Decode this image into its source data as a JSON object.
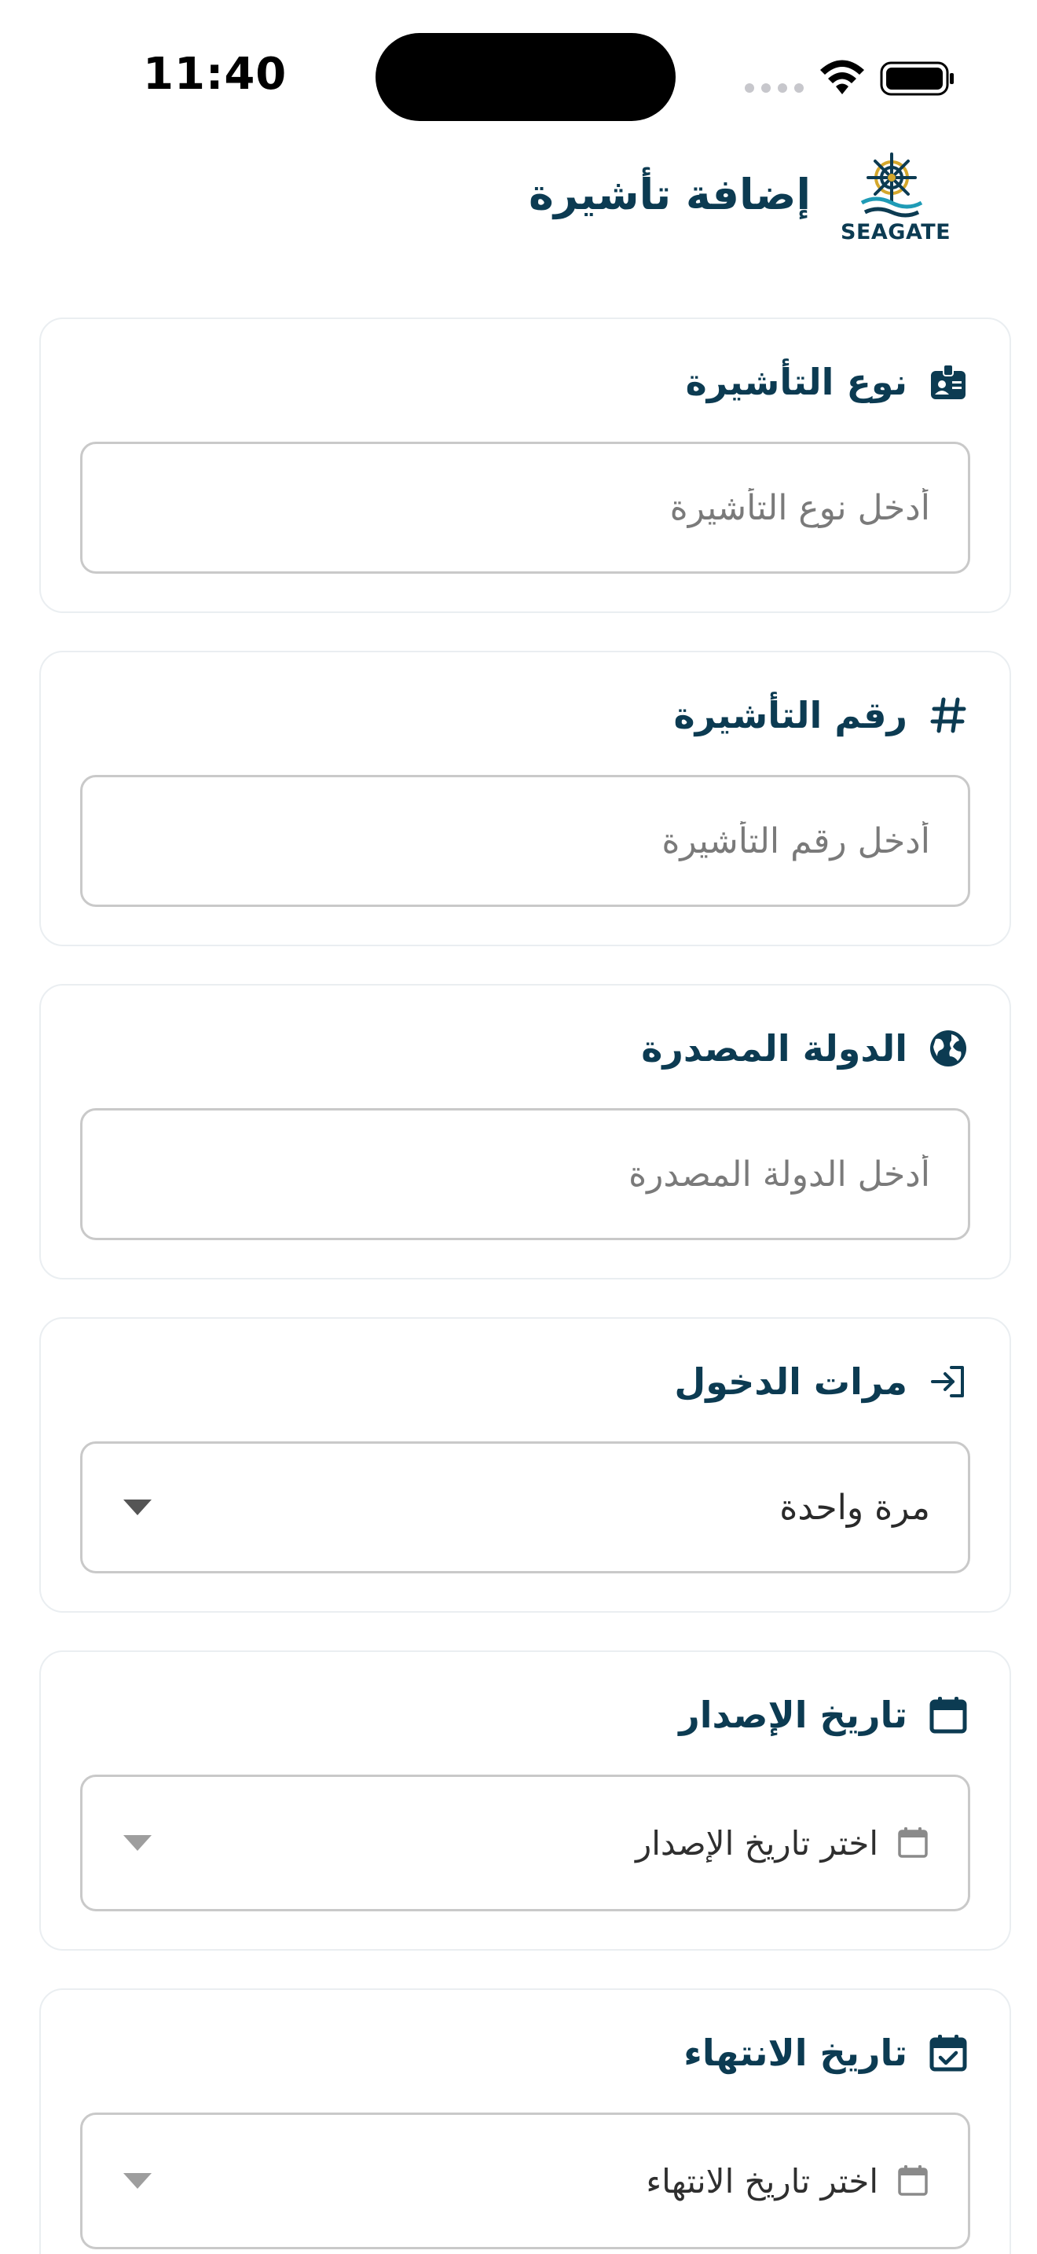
{
  "status_bar": {
    "time": "11:40"
  },
  "header": {
    "title": "إضافة تأشيرة",
    "logo_text": "SEAGATE"
  },
  "form": {
    "visa_type": {
      "label": "نوع التأشيرة",
      "placeholder": "أدخل نوع التأشيرة",
      "icon": "id-badge-icon"
    },
    "visa_number": {
      "label": "رقم التأشيرة",
      "placeholder": "أدخل رقم التأشيرة",
      "icon": "hash-icon"
    },
    "issuing_country": {
      "label": "الدولة المصدرة",
      "placeholder": "أدخل الدولة المصدرة",
      "icon": "globe-icon"
    },
    "entries": {
      "label": "مرات الدخول",
      "value": "مرة واحدة",
      "icon": "login-icon"
    },
    "issue_date": {
      "label": "تاريخ الإصدار",
      "placeholder": "اختر تاريخ الإصدار",
      "icon": "calendar-icon"
    },
    "expiry_date": {
      "label": "تاريخ الانتهاء",
      "placeholder": "اختر تاريخ الانتهاء",
      "icon": "calendar-check-icon"
    }
  },
  "colors": {
    "primary": "#0c3b52",
    "border": "#c9c9c9",
    "card_border": "#eaeef1",
    "accent_gold": "#d4a72c"
  }
}
